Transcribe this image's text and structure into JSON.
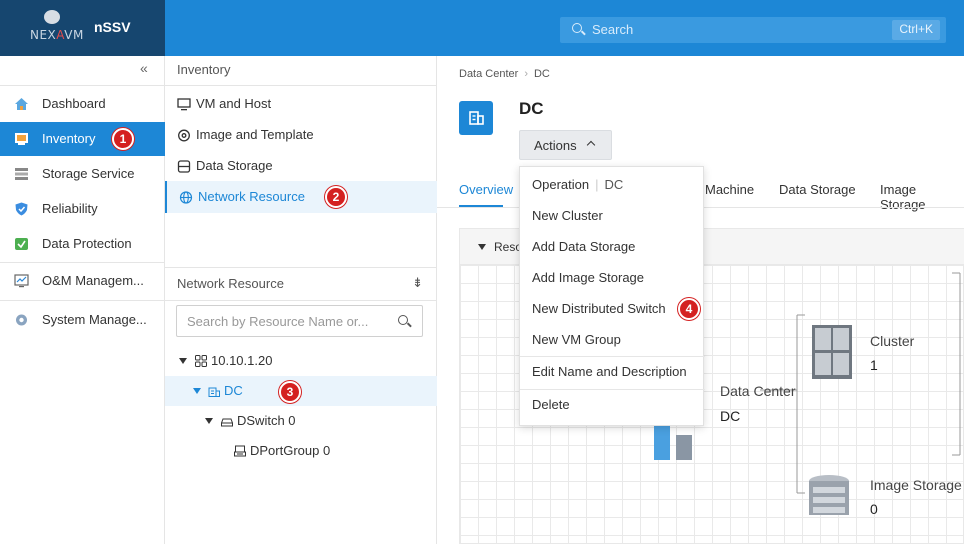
{
  "app": {
    "logo_text_a": "NEX",
    "logo_text_b": "A",
    "logo_text_c": "VM",
    "title": "nSSV",
    "search_placeholder": "Search",
    "search_shortcut": "Ctrl+K"
  },
  "colors": {
    "accent": "#1d87d6",
    "header_dark": "#16466f",
    "badge": "#d42020"
  },
  "leftnav": {
    "collapse_glyph": "«",
    "items": [
      {
        "label": "Dashboard",
        "icon": "home-icon"
      },
      {
        "label": "Inventory",
        "icon": "inventory-icon",
        "active": true
      },
      {
        "label": "Storage Service",
        "icon": "storage-service-icon"
      },
      {
        "label": "Reliability",
        "icon": "shield-icon"
      },
      {
        "label": "Data Protection",
        "icon": "data-protection-icon"
      },
      {
        "label": "O&M Managem...",
        "icon": "monitor-icon"
      },
      {
        "label": "System Manage...",
        "icon": "gear-icon"
      }
    ]
  },
  "inventory_panel": {
    "header": "Inventory",
    "items": [
      {
        "label": "VM and Host",
        "icon": "monitor-icon"
      },
      {
        "label": "Image and Template",
        "icon": "disc-icon"
      },
      {
        "label": "Data Storage",
        "icon": "database-icon"
      },
      {
        "label": "Network Resource",
        "icon": "globe-icon",
        "active": true
      }
    ]
  },
  "network_panel": {
    "header": "Network Resource",
    "filter_glyph": "⇟",
    "search_placeholder": "Search by Resource Name or...",
    "tree": [
      {
        "label": "10.10.1.20",
        "icon": "cluster-node-icon",
        "level": 0
      },
      {
        "label": "DC",
        "icon": "datacenter-icon",
        "level": 1,
        "active": true
      },
      {
        "label": "DSwitch 0",
        "icon": "switch-icon",
        "level": 2
      },
      {
        "label": "DPortGroup 0",
        "icon": "portgroup-icon",
        "level": 3
      }
    ]
  },
  "badges": [
    "1",
    "2",
    "3",
    "4"
  ],
  "content": {
    "breadcrumb": [
      "Data Center",
      "DC"
    ],
    "title": "DC",
    "actions_label": "Actions",
    "tabs": [
      "Overview",
      "Machine",
      "Data Storage",
      "Image Storage"
    ],
    "section_label": "Reso",
    "topology": {
      "datacenter_label": "Data Center",
      "datacenter_value": "DC",
      "cluster_label": "Cluster",
      "cluster_value": "1",
      "image_storage_label": "Image Storage",
      "image_storage_value": "0"
    }
  },
  "dropdown": {
    "header_label": "Operation",
    "header_sub": "DC",
    "items": [
      "New Cluster",
      "Add Data Storage",
      "Add Image Storage",
      "New Distributed Switch",
      "New VM Group",
      "Edit Name and Description",
      "Delete"
    ]
  }
}
